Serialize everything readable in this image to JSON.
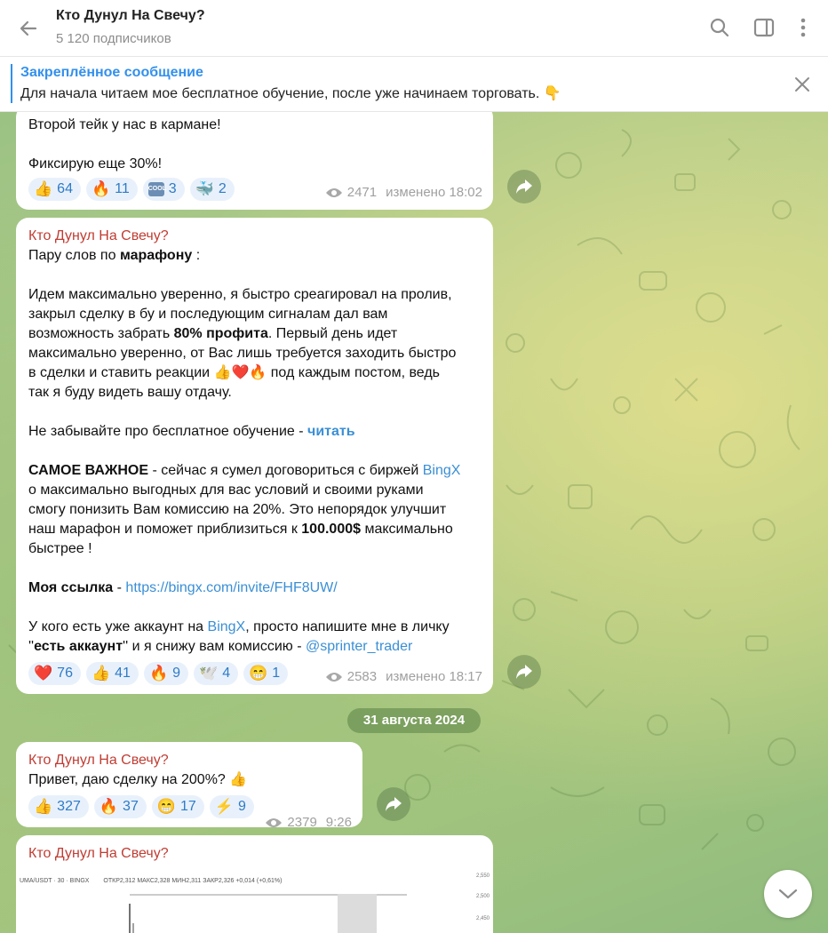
{
  "header": {
    "title": "Кто Дунул На Свечу?",
    "subscribers": "5 120 подписчиков"
  },
  "pinned": {
    "label": "Закреплённое сообщение",
    "text": "Для начала читаем мое бесплатное обучение, после уже начинаем торговать. 👇"
  },
  "messages": [
    {
      "lines": [
        "Второй тейк у нас в кармане!",
        "Фиксирую еще 30%!"
      ],
      "reactions": [
        {
          "emoji": "👍",
          "count": "64"
        },
        {
          "emoji": "🔥",
          "count": "11"
        },
        {
          "emoji": "cool",
          "count": "3"
        },
        {
          "emoji": "🐳",
          "count": "2"
        }
      ],
      "views": "2471",
      "time": "изменено 18:02"
    },
    {
      "sender": "Кто Дунул На Свечу?",
      "intro_a": "Пару слов по ",
      "intro_b": "марафону",
      "intro_c": " :",
      "p1": [
        "Идем максимально уверенно, я быстро среагировал на пролив,",
        "закрыл сделку в бу и последующим сигналам дал вам"
      ],
      "p1_line3_a": "возможность забрать ",
      "p1_line3_b": "80% профита",
      "p1_line3_c": ". Первый день идет",
      "p1_rest": [
        "максимально уверенно, от Вас лишь требуется заходить быстро",
        "в сделки и ставить реакции 👍❤️🔥 под каждым постом, ведь",
        "так я буду видеть вашу отдачу."
      ],
      "p2_a": "Не забывайте про бесплатное обучение - ",
      "p2_link": "читать",
      "p3_a": "САМОЕ ВАЖНОЕ",
      "p3_b": " - сейчас я  сумел договориться с биржей ",
      "p3_link": "BingX",
      "p3_lines": [
        "о максимально выгодных для вас условий и своими руками",
        "смогу понизить Вам комиссию на 20%. Это непорядок улучшит"
      ],
      "p3_l4_a": "наш марафон и поможет приблизиться к ",
      "p3_l4_b": "100.000$",
      "p3_l4_c": " максимально",
      "p3_l5": "быстрее !",
      "p4_a": "Моя ссылка",
      "p4_b": " - ",
      "p4_link": "https://bingx.com/invite/FHF8UW/",
      "p5_a": "У кого есть уже аккаунт на ",
      "p5_link": "BingX",
      "p5_b": ", просто напишите мне в личку",
      "p5_c": "''",
      "p5_d": "есть аккаунт",
      "p5_e": "'' и я снижу вам комиссию - ",
      "p5_link2": "@sprinter_trader",
      "reactions": [
        {
          "emoji": "❤️",
          "count": "76"
        },
        {
          "emoji": "👍",
          "count": "41"
        },
        {
          "emoji": "🔥",
          "count": "9"
        },
        {
          "emoji": "🕊️",
          "count": "4"
        },
        {
          "emoji": "😁",
          "count": "1"
        }
      ],
      "views": "2583",
      "time": "изменено 18:17"
    },
    {
      "sender": "Кто Дунул На Свечу?",
      "text": "Привет, даю сделку на 200%? 👍",
      "reactions": [
        {
          "emoji": "👍",
          "count": "327"
        },
        {
          "emoji": "🔥",
          "count": "37"
        },
        {
          "emoji": "😁",
          "count": "17"
        },
        {
          "emoji": "⚡",
          "count": "9"
        }
      ],
      "views": "2379",
      "time": "9:26"
    },
    {
      "sender": "Кто Дунул На Свечу?",
      "chart_header": "UMA/USDT · 30 · BINGX",
      "chart_ohlc": "ОТКР2,312  МАКС2,328  МИН2,311  ЗАКР2,326  +0,014 (+0,61%)",
      "chart_ticks": [
        "2,550",
        "2,500",
        "2,450"
      ]
    }
  ],
  "date_separator": "31 августа 2024"
}
